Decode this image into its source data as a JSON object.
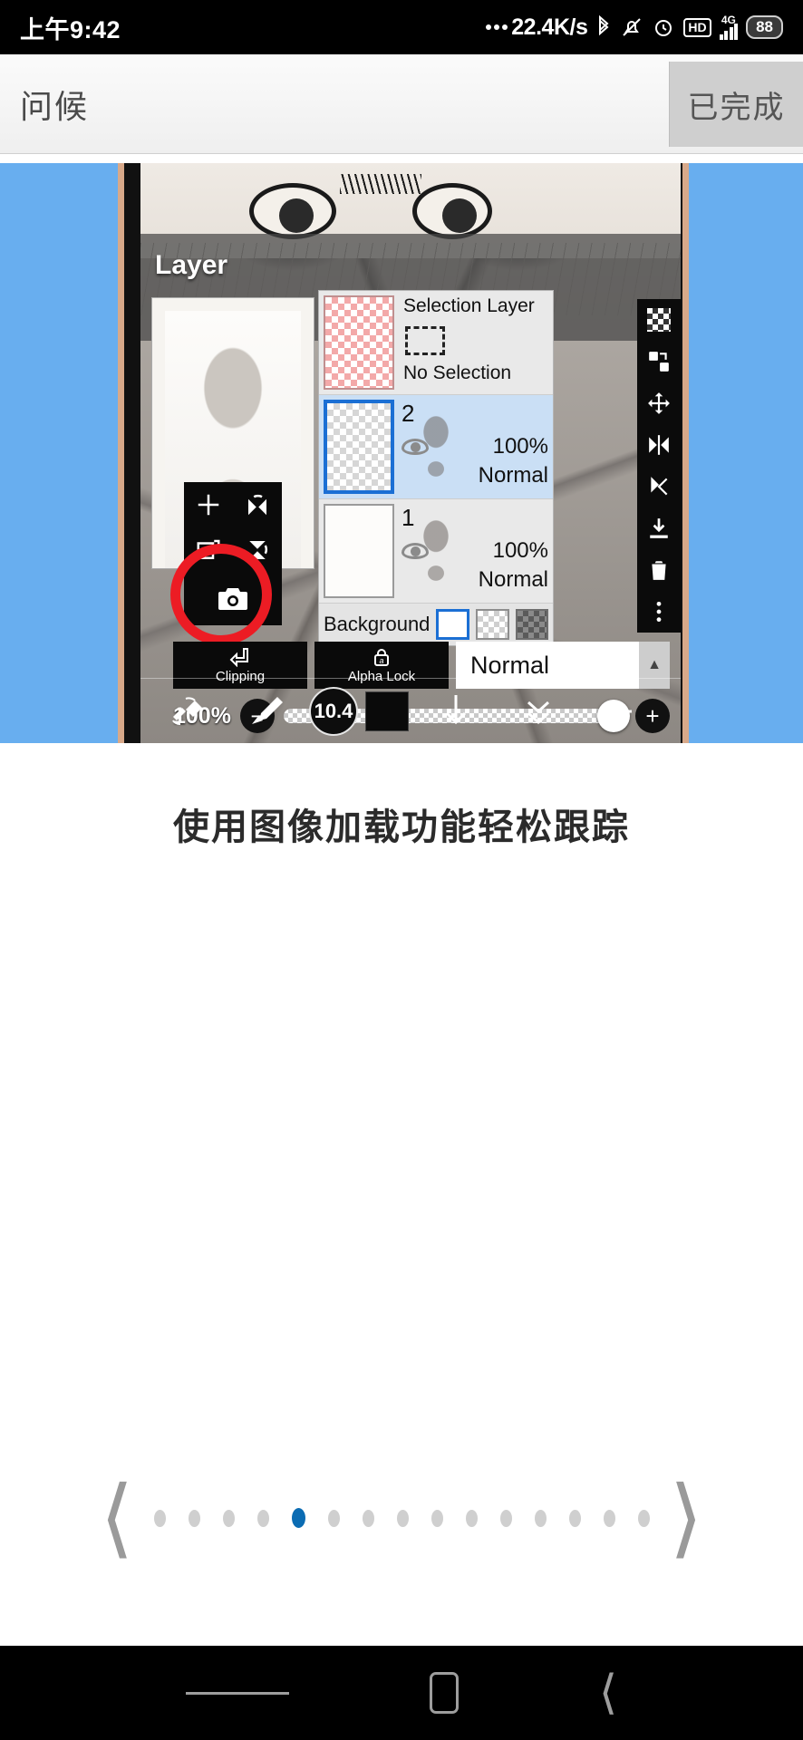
{
  "status_bar": {
    "time": "上午9:42",
    "network_speed": "22.4K/s",
    "icons": [
      "ellipsis-icon",
      "bluetooth-icon",
      "mute-bell-icon",
      "alarm-clock-icon",
      "hd-icon",
      "4g-signal-icon",
      "battery-icon"
    ],
    "hd_label": "HD",
    "network_type": "4G",
    "battery_level": "88"
  },
  "app_bar": {
    "title": "问候",
    "done_label": "已完成"
  },
  "slide": {
    "caption": "使用图像加载功能轻松跟踪",
    "background_color": "#68aeef",
    "highlight_color": "#ec1c24",
    "panel": {
      "title": "Layer",
      "selection_layer": {
        "name": "Selection Layer",
        "status": "No Selection"
      },
      "layers": [
        {
          "name": "2",
          "opacity": "100%",
          "blend": "Normal",
          "selected": true
        },
        {
          "name": "1",
          "opacity": "100%",
          "blend": "Normal",
          "selected": false
        }
      ],
      "background_label": "Background",
      "background_swatches": [
        "white",
        "transparent",
        "dark-checker"
      ],
      "clipping_label": "Clipping",
      "alpha_lock_label": "Alpha Lock",
      "blend_mode": "Normal",
      "opacity_value": "100%",
      "minus_label": "−",
      "plus_label": "+",
      "right_tools": [
        "transparency-icon",
        "transform-icon",
        "move-icon",
        "flip-horizontal-icon",
        "flip-vertical-icon",
        "merge-down-icon",
        "trash-icon",
        "more-options-icon"
      ],
      "left_tools": [
        "add-layer-icon",
        "flip-horizontal-icon",
        "duplicate-layer-icon",
        "flip-vertical-icon",
        "camera-icon"
      ]
    },
    "bottom_toolbar": {
      "tools": [
        "undo-redo-icon",
        "brush-icon",
        "color-swatch",
        "download-icon",
        "collapse-icon",
        "back-arrow-icon"
      ],
      "brush_size": "10.4"
    }
  },
  "pager": {
    "prev_icon": "chevron-left-icon",
    "next_icon": "chevron-right-icon",
    "total_dots": 15,
    "active_index": 4
  },
  "nav_bar": {
    "items": [
      "menu-icon",
      "home-icon",
      "back-icon"
    ]
  }
}
